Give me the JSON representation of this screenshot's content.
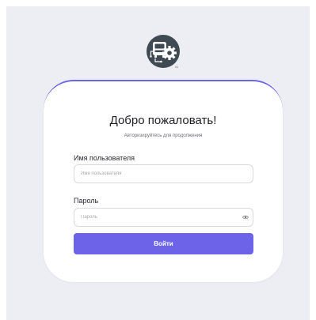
{
  "app": {
    "logo_icon": "bus-gear-icon",
    "logo_mark": "AI"
  },
  "login": {
    "title": "Добро пожаловать!",
    "subtitle": "Авторизируйтесь для продолжения",
    "username": {
      "label": "Имя пользователя",
      "placeholder": "Имя пользователя",
      "value": ""
    },
    "password": {
      "label": "Пароль",
      "placeholder": "Пароль",
      "value": "",
      "toggle_icon": "eye-icon"
    },
    "submit_label": "Войти"
  },
  "colors": {
    "accent": "#6c63e9",
    "card_border": "#6b66e8",
    "background": "#eceef3",
    "card": "#ffffff",
    "logo_circle": "#3f4a52"
  }
}
